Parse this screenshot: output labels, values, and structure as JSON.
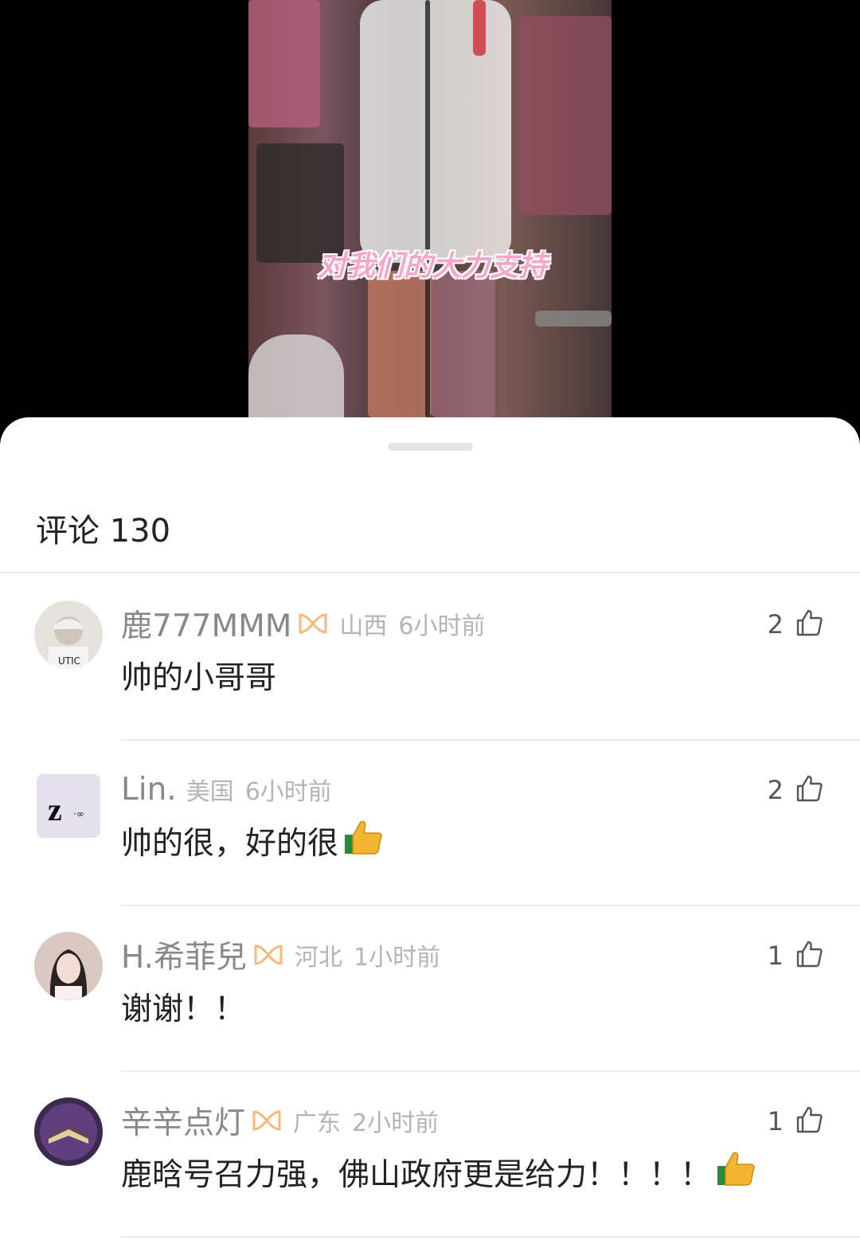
{
  "video": {
    "subtitle": "对我们的大力支持"
  },
  "comments_panel": {
    "title": "评论 130",
    "comments": [
      {
        "username": "鹿777MMM",
        "region": "山西",
        "time": "6小时前",
        "text": "帅的小哥哥",
        "likes": "2",
        "badge_icon": "vip-badge-icon",
        "emoji": ""
      },
      {
        "username": "Lin.",
        "region": "美国",
        "time": "6小时前",
        "text": "帅的很，好的很",
        "likes": "2",
        "badge_icon": "",
        "emoji": "thumbs-up-emoji"
      },
      {
        "username": "H.希菲兒",
        "region": "河北",
        "time": "1小时前",
        "text": "谢谢！！",
        "likes": "1",
        "badge_icon": "vip-badge-icon",
        "emoji": ""
      },
      {
        "username": "辛辛点灯",
        "region": "广东",
        "time": "2小时前",
        "text": "鹿晗号召力强，佛山政府更是给力！！！！",
        "likes": "1",
        "badge_icon": "vip-badge-icon",
        "emoji": "thumbs-up-emoji"
      }
    ]
  },
  "colors": {
    "badge": "#f5b87a",
    "sheet_bg": "#ffffff",
    "page_bg": "#000000"
  }
}
